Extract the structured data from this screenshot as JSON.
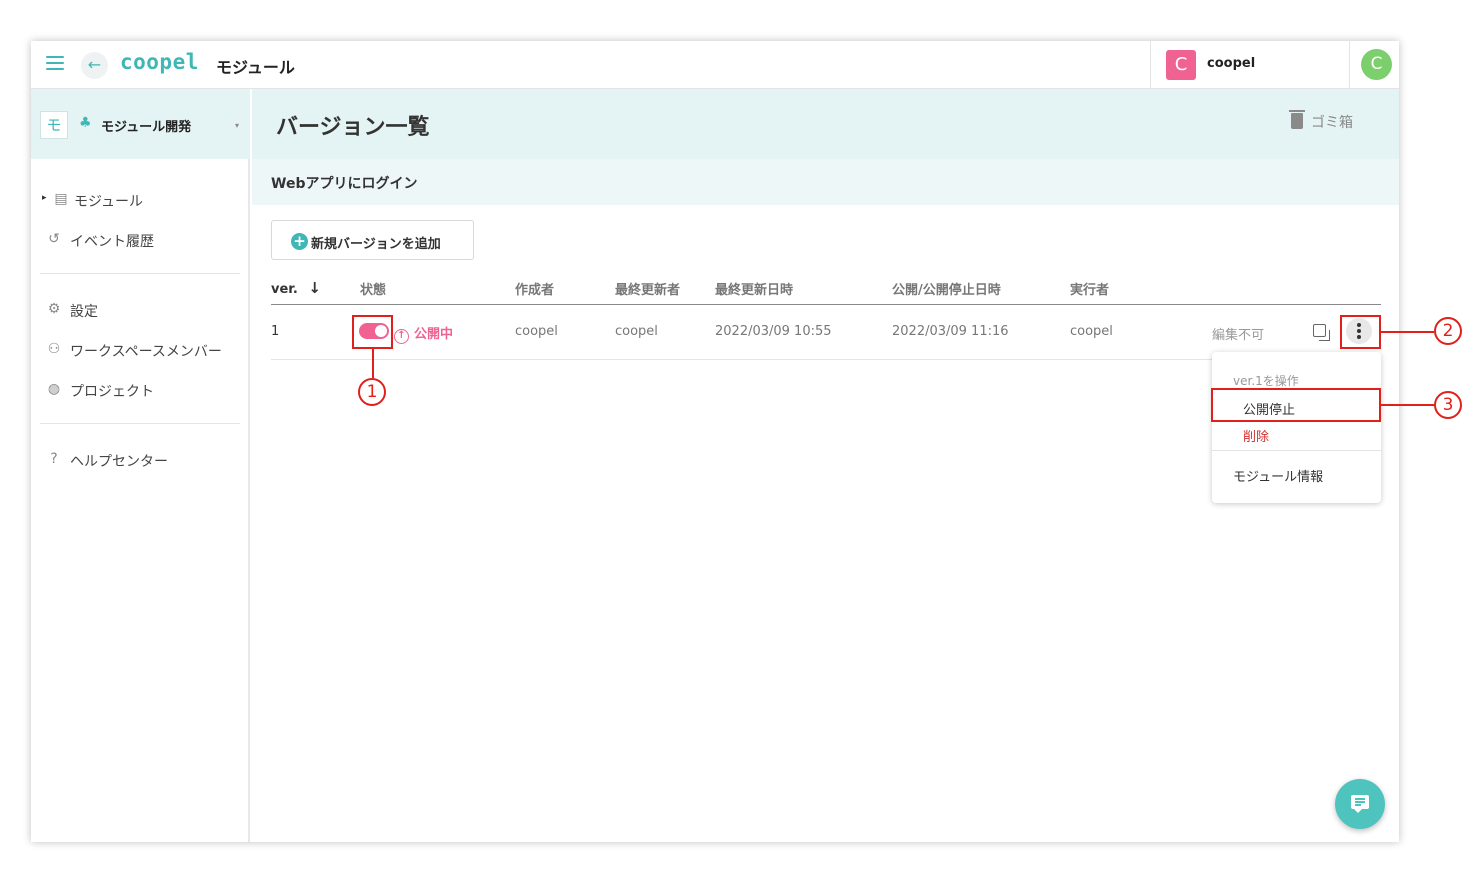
{
  "app": {
    "logo_text": "coopel",
    "title": "モジュール",
    "back_glyph": "←",
    "accent_color": "#3fb7b5",
    "danger_color": "#d32f2f",
    "published_color": "#f06292"
  },
  "header": {
    "workspace_avatar": "C",
    "workspace_name": "coopel",
    "profile_avatar": "C"
  },
  "sidebar": {
    "workspace": {
      "badge": "モ",
      "icon": "♣",
      "name": "モジュール開発",
      "caret": "▾"
    },
    "items": [
      {
        "icon": "list-icon",
        "glyph": "▤",
        "label": "モジュール",
        "expandable": true,
        "arrow": "▸"
      },
      {
        "icon": "history-icon",
        "glyph": "↺",
        "label": "イベント履歴"
      },
      {
        "icon": "gear-icon",
        "glyph": "⚙",
        "label": "設定"
      },
      {
        "icon": "users-icon",
        "glyph": "⚇",
        "label": "ワークスペースメンバー"
      },
      {
        "icon": "project-icon",
        "glyph": "◍",
        "label": "プロジェクト"
      },
      {
        "icon": "help-icon",
        "glyph": "?",
        "label": "ヘルプセンター"
      }
    ]
  },
  "page": {
    "title": "バージョン一覧",
    "trash_label": "ゴミ箱",
    "module_name": "Webアプリにログイン",
    "add_button_label": "新規バージョンを追加",
    "add_button_glyph": "+"
  },
  "table": {
    "columns": {
      "ver": "ver.",
      "sort_glyph": "↓",
      "status": "状態",
      "creator": "作成者",
      "updater": "最終更新者",
      "updated_at": "最終更新日時",
      "published_at": "公開/公開停止日時",
      "executor": "実行者"
    },
    "rows": [
      {
        "ver": "1",
        "toggle_on": true,
        "status_icon": "upload-circle-icon",
        "status_glyph": "↑",
        "status": "公開中",
        "creator": "coopel",
        "updater": "coopel",
        "updated_at": "2022/03/09 10:55",
        "published_at": "2022/03/09 11:16",
        "executor": "coopel",
        "edit_state": "編集不可"
      }
    ]
  },
  "menu": {
    "title": "ver.1を操作",
    "unpublish": "公開停止",
    "delete": "削除",
    "module_info": "モジュール情報"
  },
  "annotations": [
    "1",
    "2",
    "3"
  ]
}
